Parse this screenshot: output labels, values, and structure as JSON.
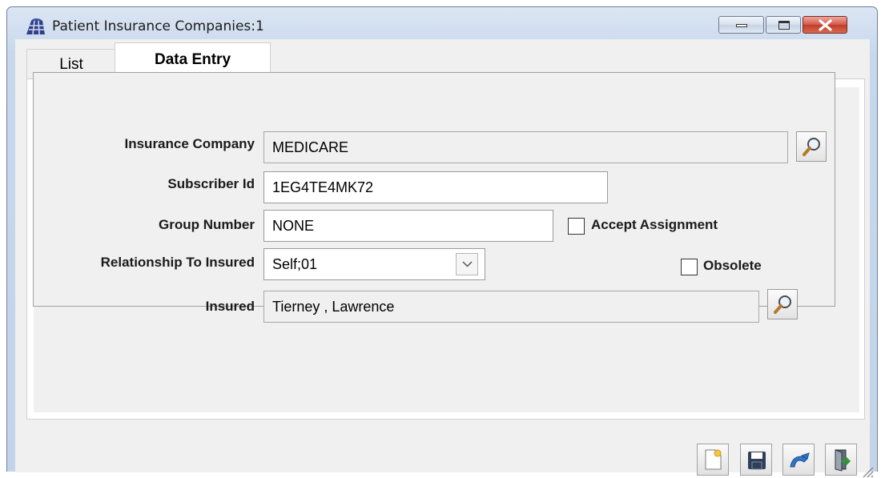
{
  "window": {
    "title": "Patient Insurance Companies:1",
    "icons": {
      "app": "building-grid-icon",
      "minimize": "minimize-icon",
      "maximize": "maximize-icon",
      "close": "close-icon"
    },
    "close_color": "#c23b2b"
  },
  "tabs": [
    {
      "label": "List",
      "active": false
    },
    {
      "label": "Data Entry",
      "active": true
    }
  ],
  "form": {
    "insurance_company": {
      "label": "Insurance Company",
      "value": "MEDICARE",
      "icon": "magnifier-icon"
    },
    "subscriber_id": {
      "label": "Subscriber Id",
      "value": "1EG4TE4MK72"
    },
    "group_number": {
      "label": "Group Number",
      "value": "NONE"
    },
    "accept_assignment": {
      "label": "Accept Assignment",
      "checked": false
    },
    "relationship": {
      "label": "Relationship To Insured",
      "value": "Self;01",
      "icon": "chevron-down-icon"
    },
    "obsolete": {
      "label": "Obsolete",
      "checked": false
    },
    "insured": {
      "label": "Insured",
      "value": "Tierney , Lawrence",
      "icon": "magnifier-icon"
    }
  },
  "toolbar": {
    "icons": [
      "new-document-icon",
      "save-icon",
      "undo-icon",
      "exit-door-icon"
    ]
  }
}
